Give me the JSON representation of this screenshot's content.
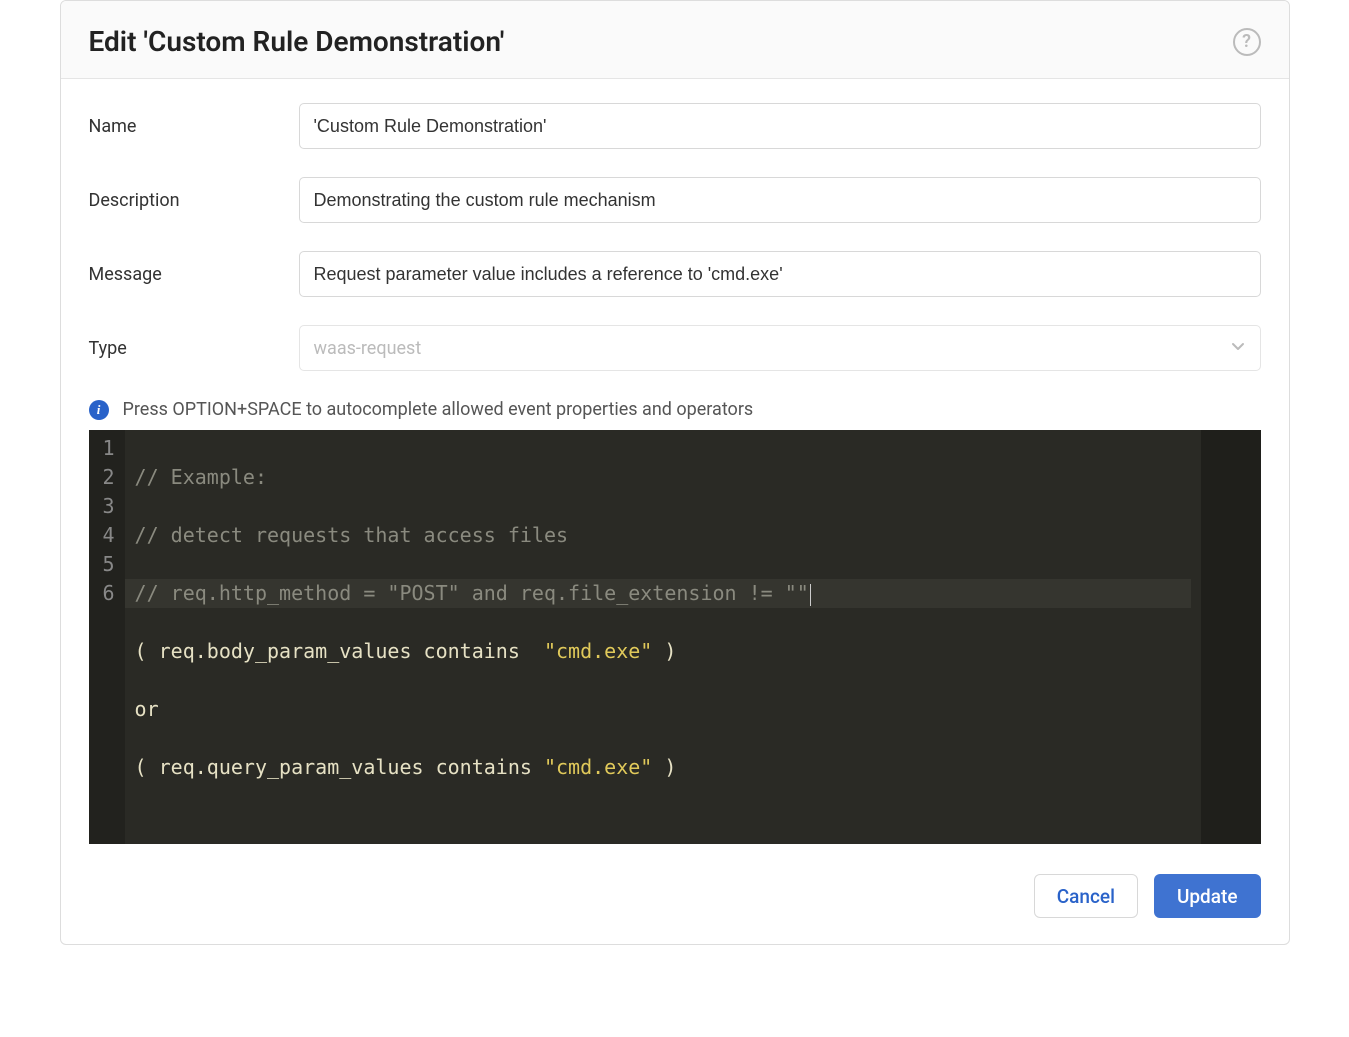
{
  "header": {
    "title": "Edit 'Custom Rule Demonstration'",
    "help": "?"
  },
  "form": {
    "labels": {
      "name": "Name",
      "description": "Description",
      "message": "Message",
      "type": "Type"
    },
    "values": {
      "name": "'Custom Rule Demonstration'",
      "description": "Demonstrating the custom rule mechanism",
      "message": "Request parameter value includes a reference to 'cmd.exe'",
      "type": "waas-request"
    }
  },
  "hint": {
    "text": "Press OPTION+SPACE to autocomplete allowed event properties and operators"
  },
  "editor": {
    "gutter": [
      "1",
      "2",
      "3",
      "4",
      "5",
      "6"
    ],
    "lines": {
      "l1_comment": "// Example:",
      "l2_comment": "// detect requests that access files",
      "l3_comment": "// req.http_method = \"POST\" and req.file_extension != \"\"",
      "l4_open": "( ",
      "l4_ident": "req.body_param_values",
      "l4_op": " contains  ",
      "l4_str": "\"cmd.exe\"",
      "l4_close": " )",
      "l5_or": "or",
      "l6_open": "( ",
      "l6_ident": "req.query_param_values",
      "l6_op": " contains ",
      "l6_str": "\"cmd.exe\"",
      "l6_close": " )"
    }
  },
  "footer": {
    "cancel": "Cancel",
    "update": "Update"
  }
}
